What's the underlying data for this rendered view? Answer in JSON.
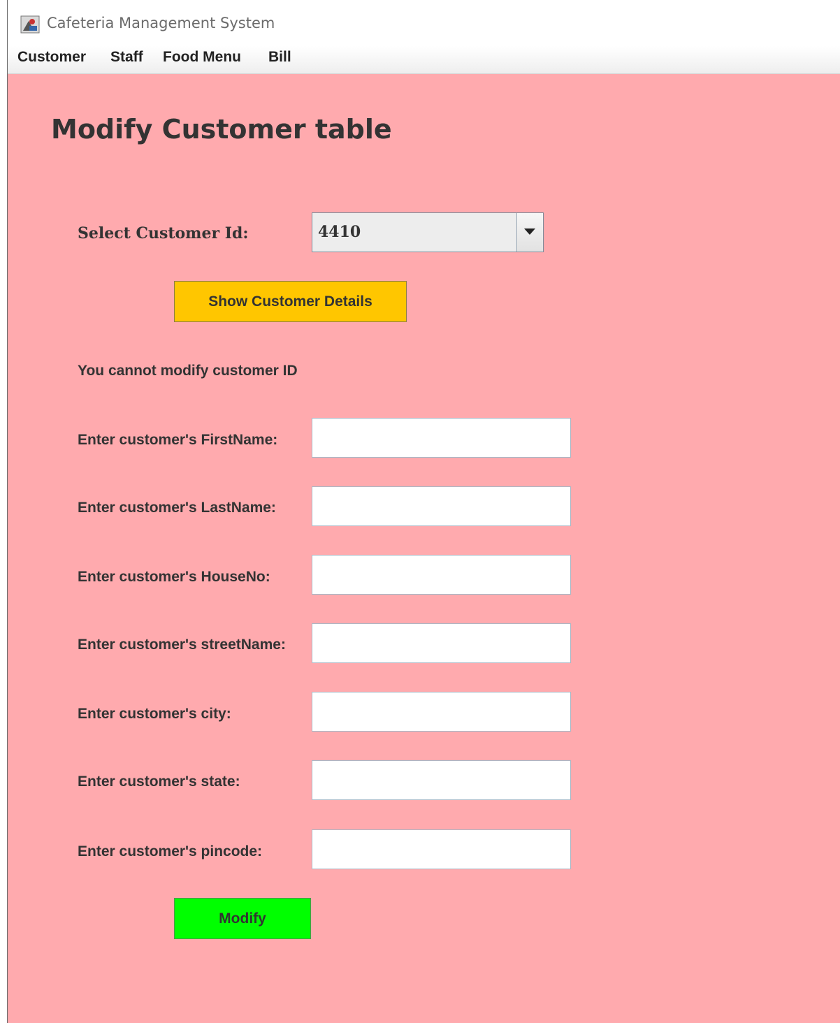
{
  "window": {
    "title": "Cafeteria Management System"
  },
  "menu": {
    "items": [
      "Customer",
      "Staff",
      "Food Menu",
      "Bill"
    ]
  },
  "form": {
    "heading": "Modify Customer table",
    "select_label": "Select Customer Id:",
    "selected_id": "4410",
    "show_button": "Show Customer Details",
    "notice": "You cannot modify customer ID",
    "fields": [
      {
        "label": "Enter customer's FirstName:",
        "value": ""
      },
      {
        "label": "Enter customer's LastName:",
        "value": ""
      },
      {
        "label": "Enter customer's HouseNo:",
        "value": ""
      },
      {
        "label": "Enter customer's streetName:",
        "value": ""
      },
      {
        "label": "Enter customer's city:",
        "value": ""
      },
      {
        "label": "Enter customer's state:",
        "value": ""
      },
      {
        "label": "Enter customer's pincode:",
        "value": ""
      }
    ],
    "modify_button": "Modify"
  },
  "colors": {
    "background": "#ffaaae",
    "show_button": "#ffc600",
    "modify_button": "#00ff00"
  },
  "icons": {
    "app": "java-app-icon",
    "combo": "chevron-down-icon"
  }
}
